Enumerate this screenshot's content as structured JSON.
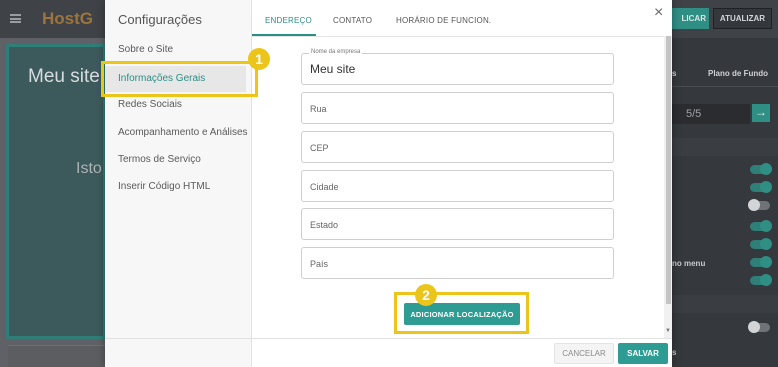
{
  "background_app": {
    "logo": "HostG",
    "publish_label": "LICAR",
    "update_label": "ATUALIZAR",
    "preview_title": "Meu site",
    "preview_subtitle": "Isto",
    "right_tab_fragment": "s",
    "right_tab_plano": "Plano de Fundo",
    "counter": "5/5",
    "menu_label_fragment": "no menu",
    "footer_fragment": "s",
    "toggles_on": [
      true,
      true,
      false,
      true,
      true,
      true,
      true,
      false
    ]
  },
  "modal": {
    "title": "Configurações",
    "sidebar_items": [
      {
        "label": "Sobre o Site",
        "active": false
      },
      {
        "label": "Informações Gerais",
        "active": true
      },
      {
        "label": "Redes Sociais",
        "active": false
      },
      {
        "label": "Acompanhamento e Análises",
        "active": false
      },
      {
        "label": "Termos de Serviço",
        "active": false
      },
      {
        "label": "Inserir Código HTML",
        "active": false
      }
    ],
    "tabs": [
      {
        "label": "ENDEREÇO",
        "active": true
      },
      {
        "label": "CONTATO",
        "active": false
      },
      {
        "label": "HORÁRIO DE FUNCION.",
        "active": false
      }
    ],
    "close_symbol": "×",
    "fields": {
      "company_name": {
        "label": "Nome da empresa",
        "value": "Meu site"
      },
      "street": {
        "placeholder": "Rua",
        "value": ""
      },
      "zip": {
        "placeholder": "CEP",
        "value": ""
      },
      "city": {
        "placeholder": "Cidade",
        "value": ""
      },
      "state": {
        "placeholder": "Estado",
        "value": ""
      },
      "country": {
        "placeholder": "País",
        "value": ""
      }
    },
    "add_location_label": "ADICIONAR LOCALIZAÇÃO",
    "cancel_label": "CANCELAR",
    "save_label": "SALVAR"
  },
  "markers": [
    "1",
    "2"
  ],
  "colors": {
    "accent": "#2e9c92",
    "highlight": "#ecc51b",
    "active_text": "#2b8f87"
  }
}
